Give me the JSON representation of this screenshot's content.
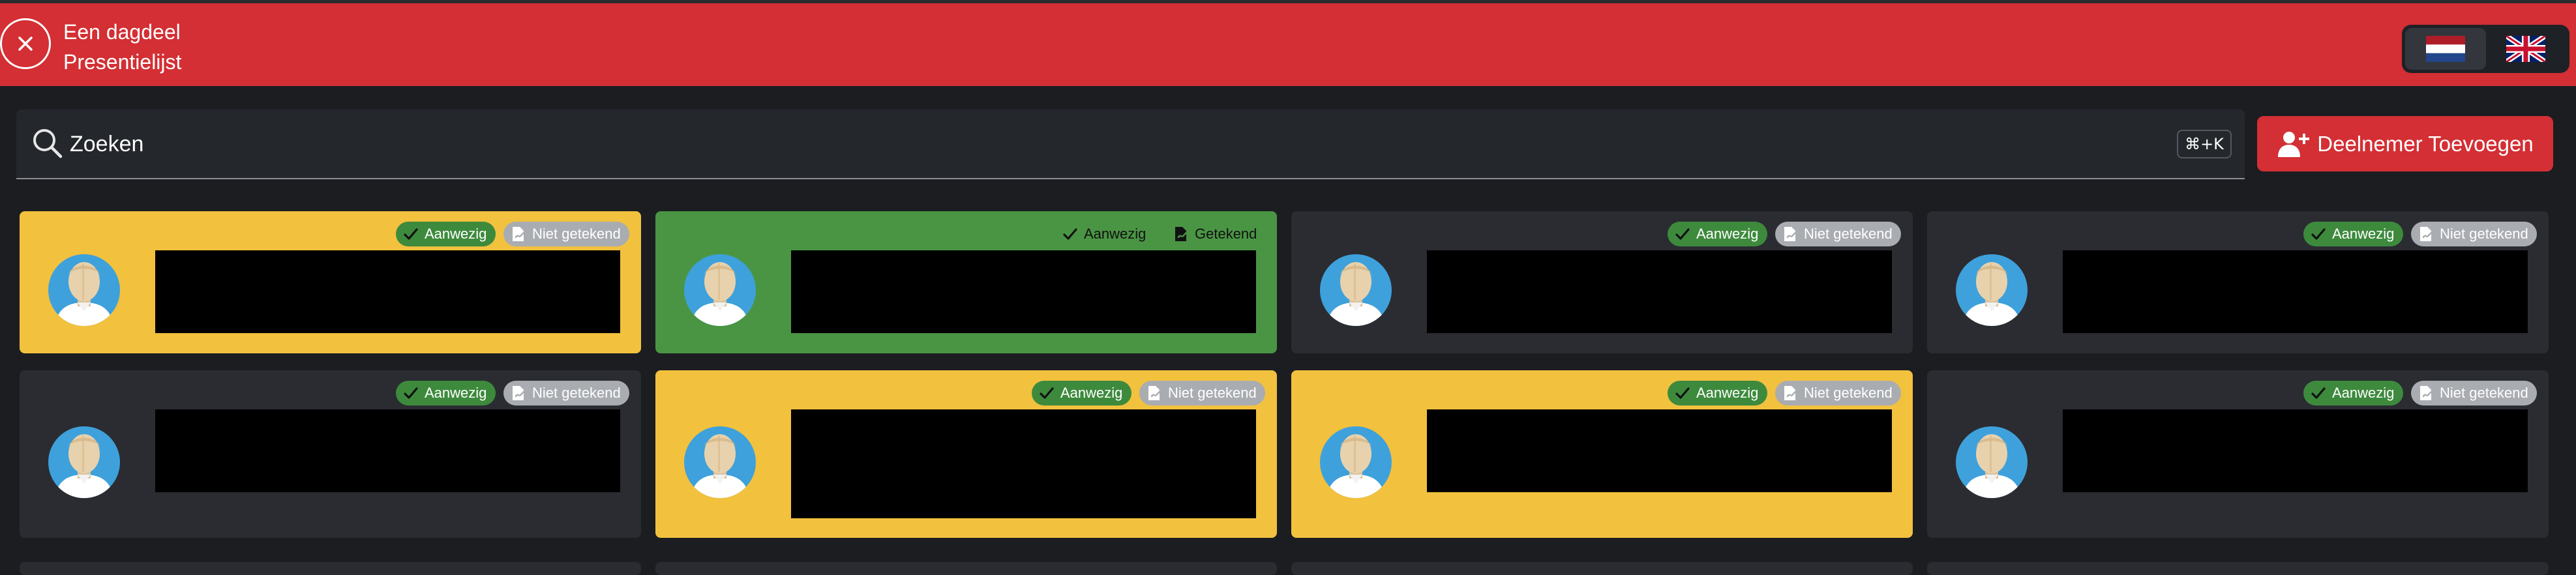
{
  "header": {
    "title": "Een dagdeel",
    "subtitle": "Presentielijst",
    "color": "#d32f34"
  },
  "languages": [
    {
      "code": "nl",
      "icon": "flag-nl-icon",
      "active": true
    },
    {
      "code": "en",
      "icon": "flag-uk-icon",
      "active": false
    }
  ],
  "search": {
    "placeholder": "Zoeken",
    "shortcut": "⌘+K"
  },
  "add_button": {
    "label": "Deelnemer Toevoegen",
    "icon": "user-plus-icon"
  },
  "status_labels": {
    "present": "Aanwezig",
    "not_signed": "Niet getekend",
    "signed": "Getekend"
  },
  "colors": {
    "yellow": "#f2c13e",
    "green": "#4a9544",
    "dark": "#2a2c31",
    "present_badge": "#3d8a3d",
    "unsigned_badge": "#a9acb1"
  },
  "participants": [
    {
      "name": "",
      "present_label": "Aanwezig",
      "sign_label": "Niet getekend",
      "card_color": "yellow",
      "signed": false
    },
    {
      "name": "",
      "present_label": "Aanwezig",
      "sign_label": "Getekend",
      "card_color": "green",
      "signed": true
    },
    {
      "name": "",
      "present_label": "Aanwezig",
      "sign_label": "Niet getekend",
      "card_color": "dark",
      "signed": false
    },
    {
      "name": "",
      "present_label": "Aanwezig",
      "sign_label": "Niet getekend",
      "card_color": "dark",
      "signed": false
    },
    {
      "name": "",
      "present_label": "Aanwezig",
      "sign_label": "Niet getekend",
      "card_color": "dark",
      "signed": false
    },
    {
      "name": "",
      "present_label": "Aanwezig",
      "sign_label": "Niet getekend",
      "card_color": "yellow",
      "signed": false
    },
    {
      "name": "",
      "present_label": "Aanwezig",
      "sign_label": "Niet getekend",
      "card_color": "yellow",
      "signed": false
    },
    {
      "name": "",
      "present_label": "Aanwezig",
      "sign_label": "Niet getekend",
      "card_color": "dark",
      "signed": false
    }
  ]
}
